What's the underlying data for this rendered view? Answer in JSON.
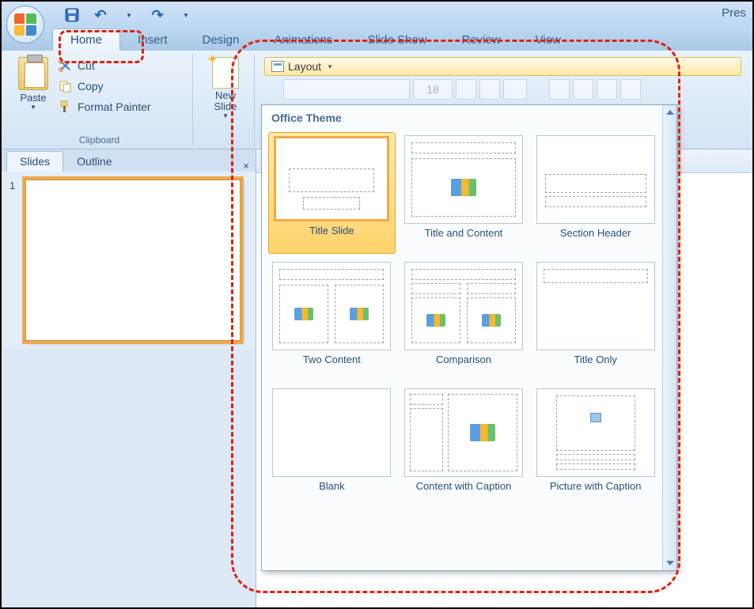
{
  "titlebar": {
    "doc_title": "Pres"
  },
  "tabs": {
    "home": "Home",
    "insert": "Insert",
    "design": "Design",
    "animations": "Animations",
    "slideshow": "Slide Show",
    "review": "Review",
    "view": "View"
  },
  "ribbon": {
    "paste_label": "Paste",
    "cut_label": "Cut",
    "copy_label": "Copy",
    "format_painter_label": "Format Painter",
    "clipboard_group": "Clipboard",
    "new_slide_label": "New\nSlide",
    "layout_label": "Layout",
    "font_size_value": "18"
  },
  "panel": {
    "slides_tab": "Slides",
    "outline_tab": "Outline",
    "thumbs": [
      {
        "num": "1"
      }
    ]
  },
  "gallery": {
    "header": "Office Theme",
    "items": [
      {
        "label": "Title Slide",
        "kind": "title",
        "selected": true
      },
      {
        "label": "Title and Content",
        "kind": "title-content"
      },
      {
        "label": "Section Header",
        "kind": "section"
      },
      {
        "label": "Two Content",
        "kind": "two-content"
      },
      {
        "label": "Comparison",
        "kind": "comparison"
      },
      {
        "label": "Title Only",
        "kind": "title-only"
      },
      {
        "label": "Blank",
        "kind": "blank"
      },
      {
        "label": "Content with Caption",
        "kind": "content-caption"
      },
      {
        "label": "Picture with Caption",
        "kind": "picture-caption"
      }
    ]
  }
}
